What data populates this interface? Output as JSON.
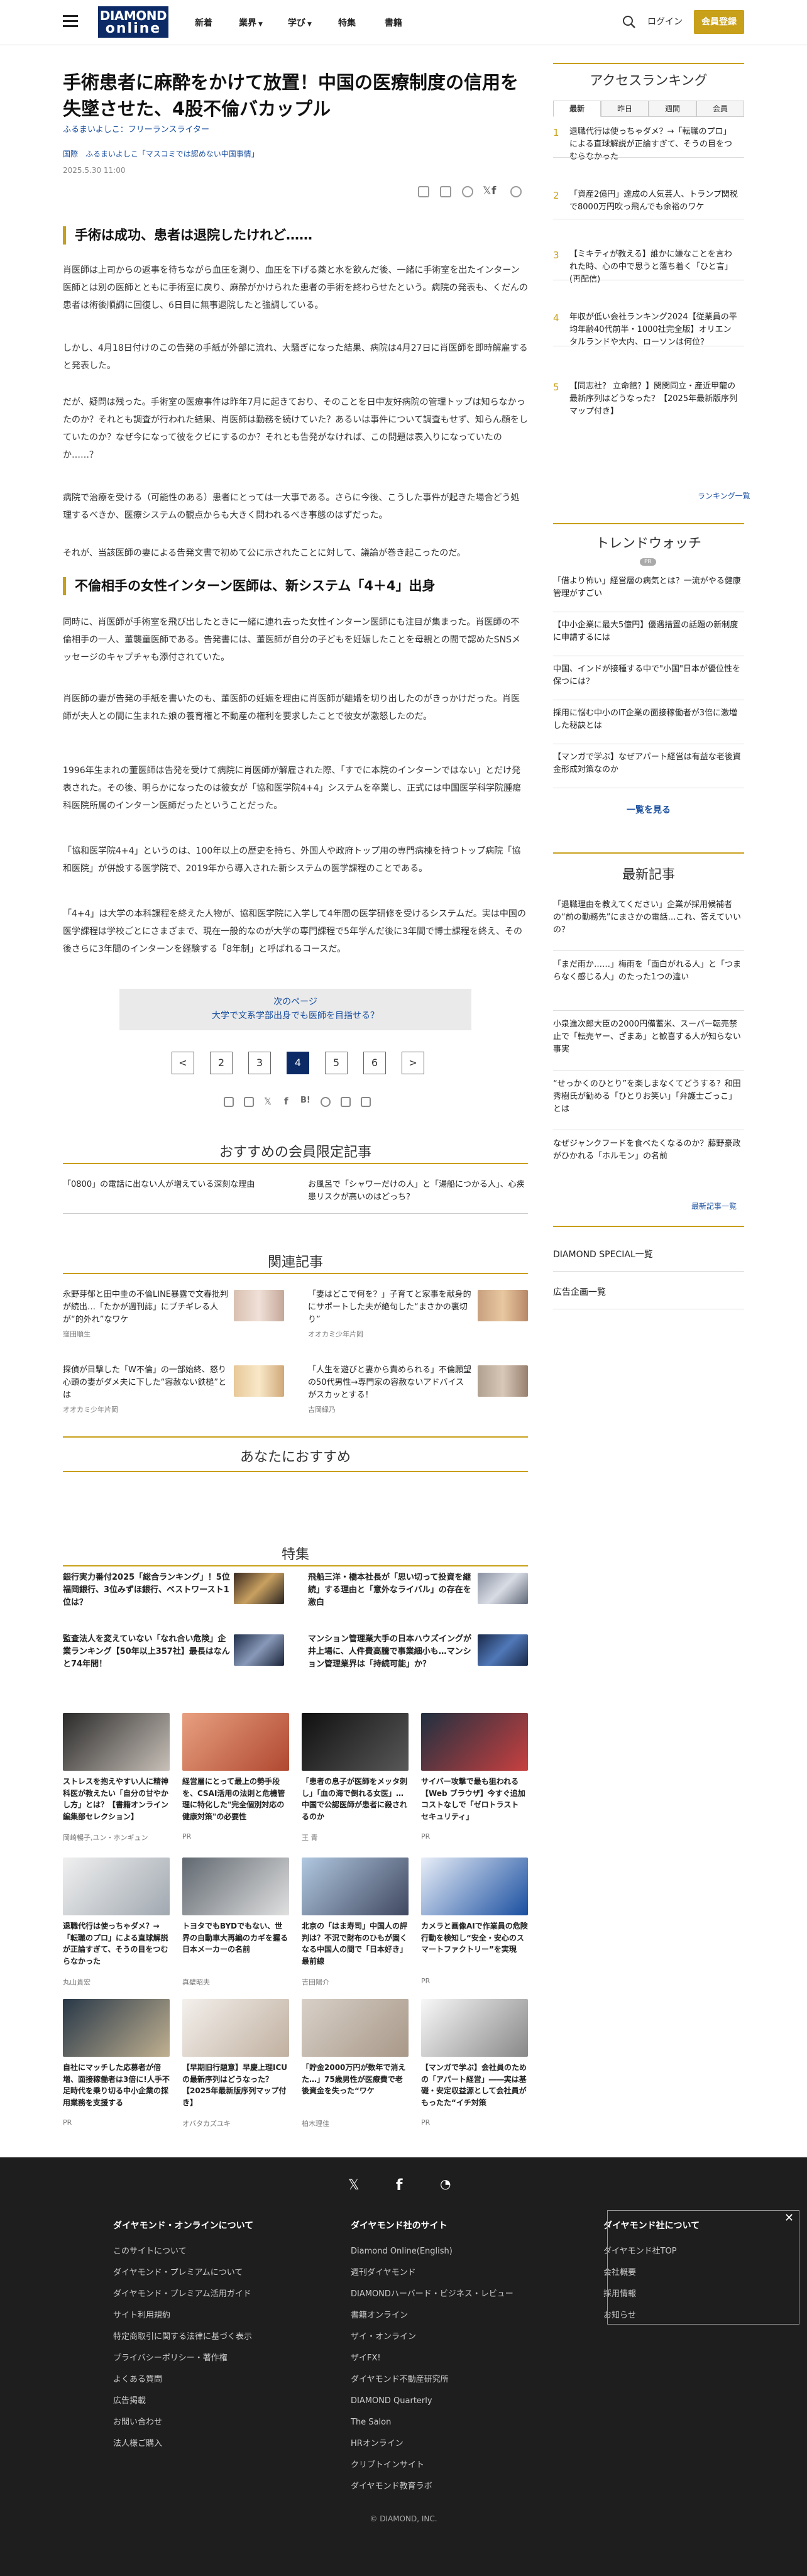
{
  "header": {
    "logo_line1": "DIAMOND",
    "logo_line2": "online",
    "nav": [
      "新着",
      "業界",
      "学び",
      "特集",
      "書籍"
    ],
    "login": "ログイン",
    "register": "会員登録"
  },
  "article": {
    "title": "手術患者に麻酔をかけて放置！中国の医療制度の信用を失墜させた、4股不倫バカップル",
    "author": "ふるまいよしこ：フリーランスライター",
    "tag1": "国際",
    "tag2": "ふるまいよしこ「マスコミでは認めない中国事情」",
    "date": "2025.5.30 11:00",
    "h2_1": "手術は成功、患者は退院したけれど……",
    "p1": "肖医師は上司からの返事を待ちながら血圧を測り、血圧を下げる薬と水を飲んだ後、一緒に手術室を出たインターン医師とは別の医師とともに手術室に戻り、麻酔がかけられた患者の手術を終わらせたという。病院の発表も、くだんの患者は術後順調に回復し、6日目に無事退院したと強調している。",
    "p2": "しかし、4月18日付けのこの告発の手紙が外部に流れ、大騒ぎになった結果、病院は4月27日に肖医師を即時解雇すると発表した。",
    "p3": "だが、疑問は残った。手術室の医療事件は昨年7月に起きており、そのことを日中友好病院の管理トップは知らなかったのか？それとも調査が行われた結果、肖医師は勤務を続けていた？あるいは事件について調査もせず、知らん顔をしていたのか？なぜ今になって彼をクビにするのか？それとも告発がなければ、この問題は表入りになっていたのか……？",
    "p4": "病院で治療を受ける（可能性のある）患者にとっては一大事である。さらに今後、こうした事件が起きた場合どう処理するべきか、医療システムの観点からも大きく問われるべき事態のはずだった。",
    "p5": "それが、当該医師の妻による告発文書で初めて公に示されたことに対して、議論が巻き起こったのだ。",
    "h2_2": "不倫相手の女性インターン医師は、新システム「4＋4」出身",
    "p6": "同時に、肖医師が手術室を飛び出したときに一緒に連れ去った女性インターン医師にも注目が集まった。肖医師の不倫相手の一人、董襲童医師である。告発書には、董医師が自分の子どもを妊娠したことを母親との間で認めたSNSメッセージのキャプチャも添付されていた。",
    "p7": "肖医師の妻が告発の手紙を書いたのも、董医師の妊娠を理由に肖医師が離婚を切り出したのがきっかけだった。肖医師が夫人との間に生まれた娘の養育権と不動産の権利を要求したことで彼女が激怒したのだ。",
    "p8": "1996年生まれの董医師は告発を受けて病院に肖医師が解雇された際、「すでに本院のインターンではない」とだけ発表された。その後、明らかになったのは彼女が「協和医学院4+4」システムを卒業し、正式には中国医学科学院腫瘍科医院所属のインターン医師だったということだった。",
    "p9": "「協和医学院4+4」というのは、100年以上の歴史を持ち、外国人や政府トップ用の専門病棟を持つトップ病院「協和医院」が併設する医学院で、2019年から導入された新システムの医学課程のことである。",
    "p10": "「4+4」は大学の本科課程を終えた人物が、協和医学院に入学して4年間の医学研修を受けるシステムだ。実は中国の医学課程は学校ごとにさまざまで、現在一般的なのが大学の専門課程で5年学んだ後に3年間で博士課程を終え、その後さらに3年間のインターンを経験する「8年制」と呼ばれるコースだ。",
    "next_label": "次のページ",
    "next_title": "大学で文系学部出身でも医師を目指せる？",
    "pages": [
      "<",
      "2",
      "3",
      "4",
      "5",
      "6",
      ">"
    ]
  },
  "member": {
    "title": "おすすめの会員限定記事",
    "items": [
      "「0800」の電話に出ない人が増えている深刻な理由",
      "お風呂で「シャワーだけの人」と「湯船につかる人」、心疾患リスクが高いのはどっち？"
    ]
  },
  "related": {
    "title": "関連記事",
    "items": [
      {
        "text": "永野芽郁と田中圭の不倫LINE暴露で文春批判が続出…「たかが週刊誌」にブチギレる人が“的外れ”なワケ",
        "meta": "窪田順生"
      },
      {
        "text": "「妻はどこで何を？」子育てと家事を献身的にサポートした夫が絶句した“まさかの裏切り”",
        "meta": "オオカミ少年片岡"
      },
      {
        "text": "探偵が目撃した「W不倫」の一部始終、怒り心頭の妻がダメ夫に下した“容赦ない鉄槌”とは",
        "meta": "オオカミ少年片岡"
      },
      {
        "text": "「人生を遊びと妻から責められる」不倫願望の50代男性→専門家の容赦ないアドバイスがスカッとする！",
        "meta": "吉岡緑乃"
      }
    ]
  },
  "recommend": {
    "title": "あなたにおすすめ"
  },
  "feature": {
    "title": "特集",
    "items": [
      "銀行実力番付2025「総合ランキング」！5位福岡銀行、3位みずほ銀行、ベストワースト1位は？",
      "飛船三洋・橋本社長が「思い切って投資を継続」する理由と「意外なライバル」の存在を激白",
      "監査法人を変えていない「なれ合い危険」企業ランキング【50年以上357社】最長はなんと74年間！",
      "マンション管理業大手の日本ハウズイングが井上場に、人件費高騰で事業細小も…マンション管理業界は「持続可能」か？"
    ]
  },
  "grid": [
    {
      "text": "ストレスを抱えやすい人に精神科医が教えたい「自分の甘やかし方」とは？【書籍オンライン編集部セレクション】",
      "meta": "岡崎暢子,ユン・ホンギュン"
    },
    {
      "text": "経営層にとって最上の勢手段を、CSAI活用の法則と危機管理に特化した\"完全個別対応の健康対策\"の必要性",
      "meta": "PR"
    },
    {
      "text": "「患者の息子が医師をメッタ刺し」「血の海で倒れる女医」…中国で公認医師が患者に殺されるのか",
      "meta": "王 青"
    },
    {
      "text": "サイバー攻撃で最も狙われる【Web ブラウザ】今すぐ追加コストなしで「ゼロトラスト セキュリティ」",
      "meta": "PR"
    },
    {
      "text": "退職代行は使っちゃダメ？→「転職のプロ」による直球解説が正論すぎて、そうの目をつむらなかった",
      "meta": "丸山貴宏"
    },
    {
      "text": "トヨタでもBYDでもない、世界の自動車大再編のカギを握る日本メーカーの名前",
      "meta": "真壁昭夫"
    },
    {
      "text": "北京の「はま寿司」中国人の評判は？不況で財布のひもが固くなる中国人の間で「日本好き」最前線",
      "meta": "吉田陽介"
    },
    {
      "text": "カメラと画像AIで作業員の危険行動を検知し“安全・安心のスマートファクトリー”を実現",
      "meta": "PR"
    },
    {
      "text": "自社にマッチした応募者が倍増、面接稼働者は3倍に!人手不足時代を乗り切る中小企業の採用業務を支援する",
      "meta": "PR"
    },
    {
      "text": "【早期旧行題意】早慶上理ICUの最新序列はどうなった？【2025年最新版序列マップ付き】",
      "meta": "オバタカズユキ"
    },
    {
      "text": "「貯金2000万円が数年で消えた…」75歳男性が医療費で老後資金を失った“ワケ",
      "meta": "柏木理佳"
    },
    {
      "text": "【マンガで学ぶ】会社員のための「アパート経営」――実は基礎・安定収益源として会社員がもったた“イチ対策",
      "meta": "PR"
    }
  ],
  "sidebar": {
    "ranking_title": "アクセスランキング",
    "tabs": [
      "最新",
      "昨日",
      "週間",
      "会員"
    ],
    "ranking": [
      {
        "n": "1",
        "t": "退職代行は使っちゃダメ？→「転職のプロ」による直球解説が正論すぎて、そうの目をつむらなかった"
      },
      {
        "n": "2",
        "t": "「資産2億円」達成の人気芸人、トランプ関税で8000万円吹っ飛んでも余裕のワケ"
      },
      {
        "n": "3",
        "t": "【ミキティが教える】誰かに嫌なことを言われた時、心の中で思うと落ち着く「ひと言」(再配信)"
      },
      {
        "n": "4",
        "t": "年収が低い会社ランキング2024【従業員の平均年齢40代前半・1000社完全版】オリエンタルランドや大内、ローソンは何位？"
      },
      {
        "n": "5",
        "t": "【同志社？ 立命館？】関関同立・産近甲龍の最新序列はどうなった？【2025年最新版序列マップ付き】"
      }
    ],
    "ranking_link": "ランキング一覧",
    "trend_title": "トレンドウォッチ",
    "trend_pr": "PR",
    "trend": [
      "「借より怖い」経営層の病気とは？一流がやる健康管理がすごい",
      "【中小企業に最大5億円】優遇措置の話題の新制度に申請するには",
      "中国、インドが接種する中で\"小国\"日本が優位性を保つには？",
      "採用に悩む中小のIT企業の面接稼働者が3倍に激増した秘訣とは",
      "【マンガで学ぶ】なぜアパート経営は有益な老後資金形成対策なのか"
    ],
    "trend_more": "一覧を見る",
    "latest_title": "最新記事",
    "latest": [
      "「退職理由を教えてください」企業が採用候補者の“前の勤務先”にまさかの電話…これ、答えていいの？",
      "「まだ雨か……」梅雨を「面白がれる人」と「つまらなく感じる人」のたった1つの違い",
      "小泉進次郎大臣の2000円備蓄米、スーパー転売禁止で「転売ヤー、ざまあ」と歓喜する人が知らない事実",
      "“せっかくのひとり”を楽しまなくてどうする？和田秀樹氏が勧める「ひとりお笑い」「弁護士ごっこ」とは",
      "なぜジャンクフードを食べたくなるのか？藤野豪政がひかれる「ホルモン」の名前"
    ],
    "latest_link": "最新記事一覧",
    "special": "DIAMOND SPECIAL一覧",
    "ad": "広告企画一覧"
  },
  "footer": {
    "col1_title": "ダイヤモンド・オンラインについて",
    "col1": [
      "このサイトについて",
      "ダイヤモンド・プレミアムについて",
      "ダイヤモンド・プレミアム活用ガイド",
      "サイト利用規約",
      "特定商取引に関する法律に基づく表示",
      "プライバシーポリシー・著作権",
      "よくある質問",
      "広告掲載",
      "お問い合わせ",
      "法人様ご購入"
    ],
    "col2_title": "ダイヤモンド社のサイト",
    "col2": [
      "Diamond Online(English)",
      "週刊ダイヤモンド",
      "DIAMONDハーバード・ビジネス・レビュー",
      "書籍オンライン",
      "ザイ・オンライン",
      "ザイFX!",
      "ダイヤモンド不動産研究所",
      "DIAMOND Quarterly",
      "The Salon",
      "HRオンライン",
      "クリプトインサイト",
      "ダイヤモンド教育ラボ"
    ],
    "col3_title": "ダイヤモンド社について",
    "col3": [
      "ダイヤモンド社TOP",
      "会社概要",
      "採用情報",
      "お知らせ"
    ],
    "copyright": "© DIAMOND, INC."
  },
  "colors": {
    "navy": "#0b2a66",
    "gold": "#c8a019",
    "link": "#1a4fa0"
  }
}
